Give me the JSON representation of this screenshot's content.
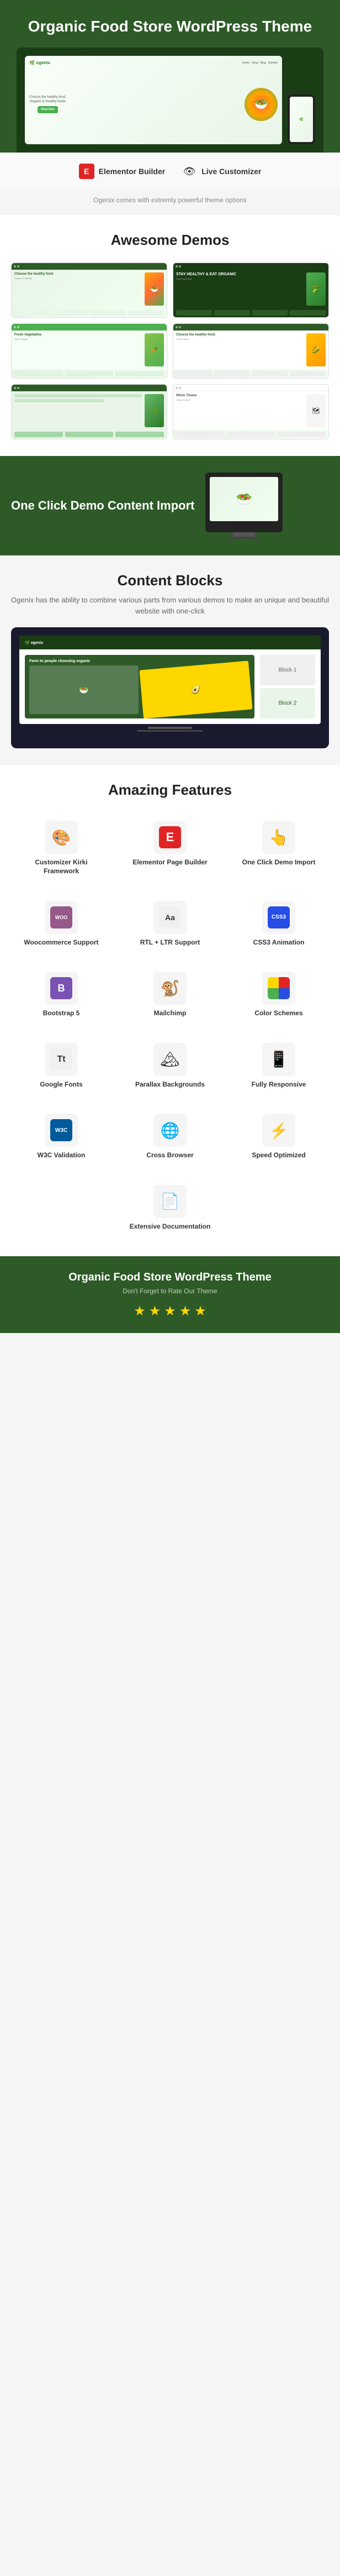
{
  "header": {
    "title": "Organic Food Store WordPress Theme",
    "laptop_text": "Choose the healthy food.",
    "laptop_sub": "Organic & Healthy foods",
    "btn_label": "Shop Now"
  },
  "features_bar": {
    "item1_label": "Elementor Builder",
    "item2_label": "Live Customizer",
    "description": "Ogenix comes with extremly powerful theme options"
  },
  "demos": {
    "title": "Awesome Demos"
  },
  "one_click": {
    "title": "One Click Demo Content Import"
  },
  "content_blocks": {
    "title": "Content Blocks",
    "description": "Ogenix has the ability to combine various parts from various demos to make an unique and beautiful website with one-click"
  },
  "amazing_features": {
    "title": "Amazing Features",
    "features": [
      {
        "label": "Customizer Kirki Framework",
        "icon": "🎨"
      },
      {
        "label": "Elementor Page Builder",
        "icon": "E"
      },
      {
        "label": "One Click Demo Import",
        "icon": "👆"
      },
      {
        "label": "Woocommerce Support",
        "icon": "WOO"
      },
      {
        "label": "RTL + LTR Support",
        "icon": "Aa"
      },
      {
        "label": "CSS3 Animation",
        "icon": "CSS"
      },
      {
        "label": "Bootstrap 5",
        "icon": "B"
      },
      {
        "label": "Mailchimp",
        "icon": "🐒"
      },
      {
        "label": "Color Schemes",
        "icon": "🎨"
      },
      {
        "label": "Google Fonts",
        "icon": "Tt"
      },
      {
        "label": "Parallax Backgrounds",
        "icon": "🏔"
      },
      {
        "label": "Fully Responsive",
        "icon": "📱"
      },
      {
        "label": "W3C Validation",
        "icon": "W3C"
      },
      {
        "label": "Cross Browser",
        "icon": "🌐"
      },
      {
        "label": "Speed Optimized",
        "icon": "⚡"
      },
      {
        "label": "Extensive Documentation",
        "icon": "📄"
      }
    ]
  },
  "footer": {
    "title": "Organic Food Store WordPress Theme",
    "tagline": "Don't Forget to Rate Our Theme",
    "stars": [
      "★",
      "★",
      "★",
      "★",
      "★"
    ]
  }
}
